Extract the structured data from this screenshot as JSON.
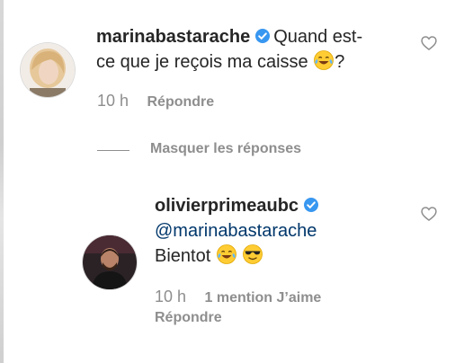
{
  "comment1": {
    "username": "marinabastarache",
    "text_line1": "Quand est-",
    "text_line2": "ce que je reçois ma caisse",
    "text_suffix": "?",
    "emoji": "face-with-tears-of-joy",
    "time": "10 h",
    "reply_label": "Répondre"
  },
  "replies_toggle": {
    "label": "Masquer les réponses"
  },
  "comment2": {
    "username": "olivierprimeaubc",
    "mention": "@marinabastarache",
    "text": "Bientot",
    "emojis": [
      "face-with-tears-of-joy",
      "smiling-face-with-sunglasses"
    ],
    "time": "10 h",
    "likes_label": "1 mention J’aime",
    "reply_label": "Répondre"
  },
  "colors": {
    "verified": "#3897f0",
    "mention": "#00376b",
    "meta": "#8e8e8e"
  }
}
